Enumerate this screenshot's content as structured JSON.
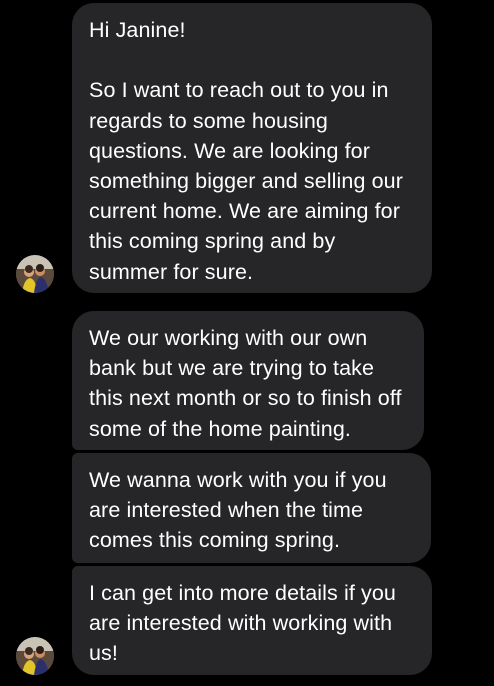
{
  "conversation": {
    "messages": [
      {
        "text": "Hi Janine!\n\nSo I want to reach out to you in regards to some housing questions. We are looking for something bigger and selling our current home.  We are aiming for this coming spring and by summer for sure."
      },
      {
        "text": "We our working with our own bank but we are trying to take this next month or so to finish off some of the home painting."
      },
      {
        "text": "We wanna work with you if you are interested when the time comes this coming spring."
      },
      {
        "text": "I can get into more details if you are interested with working with us!"
      }
    ]
  },
  "colors": {
    "background": "#000000",
    "bubble": "#262628",
    "text": "#ffffff"
  },
  "icons": {
    "avatar": "contact-avatar-photo"
  }
}
